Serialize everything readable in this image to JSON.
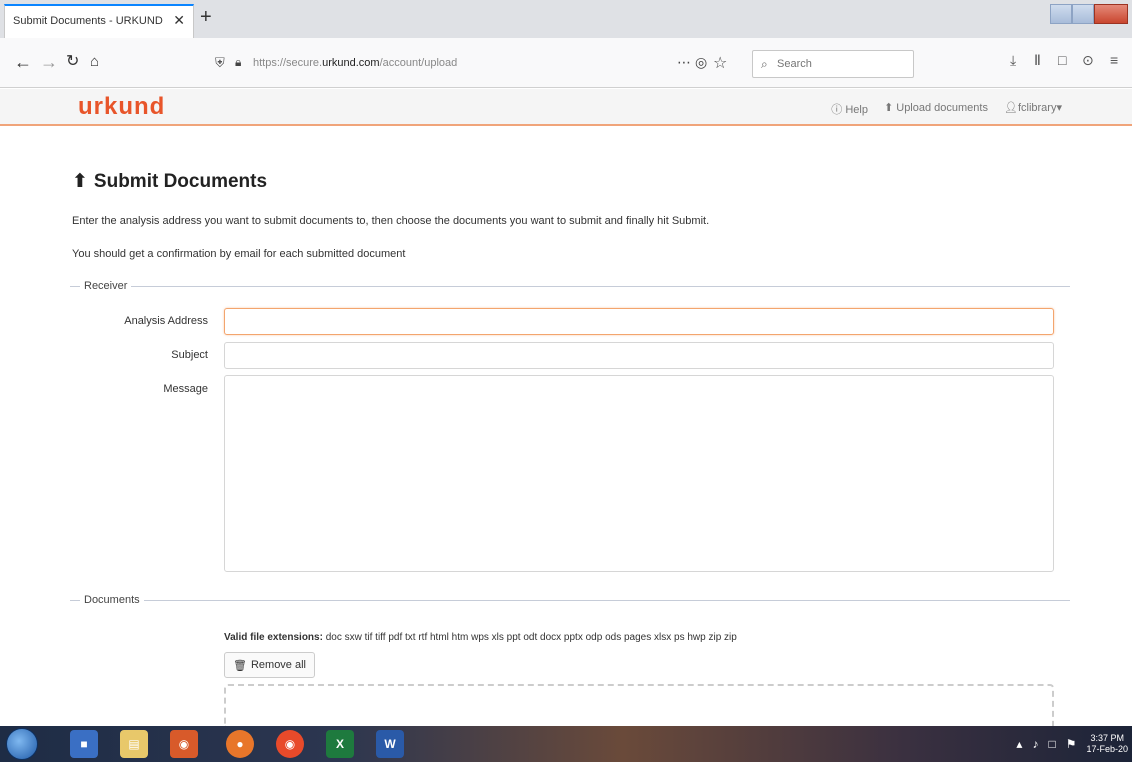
{
  "browser": {
    "tab_title": "Submit Documents - URKUND",
    "tab_close": "✕",
    "new_tab": "+",
    "url_host": "https://secure.urkund.com",
    "url_path": "/account/upload",
    "url_prefix": "https://secure.",
    "url_domain": "urkund.com",
    "search_placeholder": "Search"
  },
  "site": {
    "logo": "urkund",
    "nav": {
      "help": "Help",
      "upload": "Upload documents",
      "account": "fclibrary"
    }
  },
  "page": {
    "title": "Submit Documents",
    "intro_1": "Enter the analysis address you want to submit documents to, then choose the documents you want to submit and finally hit Submit.",
    "intro_2": "You should get a confirmation by email for each submitted document"
  },
  "receiver": {
    "legend": "Receiver",
    "analysis_label": "Analysis Address",
    "analysis_value": "",
    "subject_label": "Subject",
    "subject_value": "",
    "message_label": "Message",
    "message_value": ""
  },
  "documents": {
    "legend": "Documents",
    "valid_label": "Valid file extensions:",
    "valid_list": "doc sxw tif tiff pdf txt rtf html htm wps xls ppt odt docx pptx odp ods pages xlsx ps hwp zip zip",
    "remove_all": "Remove all"
  },
  "taskbar": {
    "time": "3:37 PM",
    "date": "17-Feb-20"
  }
}
